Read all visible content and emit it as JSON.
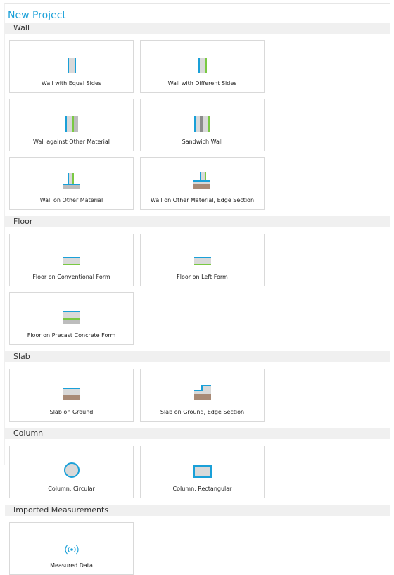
{
  "window": {
    "title": "New Project"
  },
  "sections": {
    "wall": {
      "label": "Wall",
      "items": [
        {
          "label": "Wall with Equal Sides",
          "icon": "wall-equal-sides-icon"
        },
        {
          "label": "Wall with Different Sides",
          "icon": "wall-different-sides-icon"
        },
        {
          "label": "Wall against Other Material",
          "icon": "wall-against-material-icon"
        },
        {
          "label": "Sandwich Wall",
          "icon": "sandwich-wall-icon"
        },
        {
          "label": "Wall on Other Material",
          "icon": "wall-on-material-icon"
        },
        {
          "label": "Wall on Other Material, Edge Section",
          "icon": "wall-on-material-edge-icon"
        }
      ]
    },
    "floor": {
      "label": "Floor",
      "items": [
        {
          "label": "Floor on Conventional Form",
          "icon": "floor-conventional-form-icon"
        },
        {
          "label": "Floor on Left Form",
          "icon": "floor-left-form-icon"
        },
        {
          "label": "Floor on Precast Concrete Form",
          "icon": "floor-precast-form-icon"
        }
      ]
    },
    "slab": {
      "label": "Slab",
      "items": [
        {
          "label": "Slab on Ground",
          "icon": "slab-on-ground-icon"
        },
        {
          "label": "Slab on Ground, Edge Section",
          "icon": "slab-on-ground-edge-icon"
        }
      ]
    },
    "column": {
      "label": "Column",
      "items": [
        {
          "label": "Column, Circular",
          "icon": "column-circular-icon"
        },
        {
          "label": "Column, Rectangular",
          "icon": "column-rectangular-icon"
        }
      ]
    },
    "imported": {
      "label": "Imported Measurements",
      "items": [
        {
          "label": "Measured Data",
          "icon": "measured-data-icon"
        }
      ]
    }
  },
  "colors": {
    "accent_blue": "#1aa0d8",
    "accent_green": "#7ac943",
    "concrete_gray": "#d9d9d9",
    "ground_brown": "#a88a76",
    "section_bg": "#f0f0f0"
  }
}
